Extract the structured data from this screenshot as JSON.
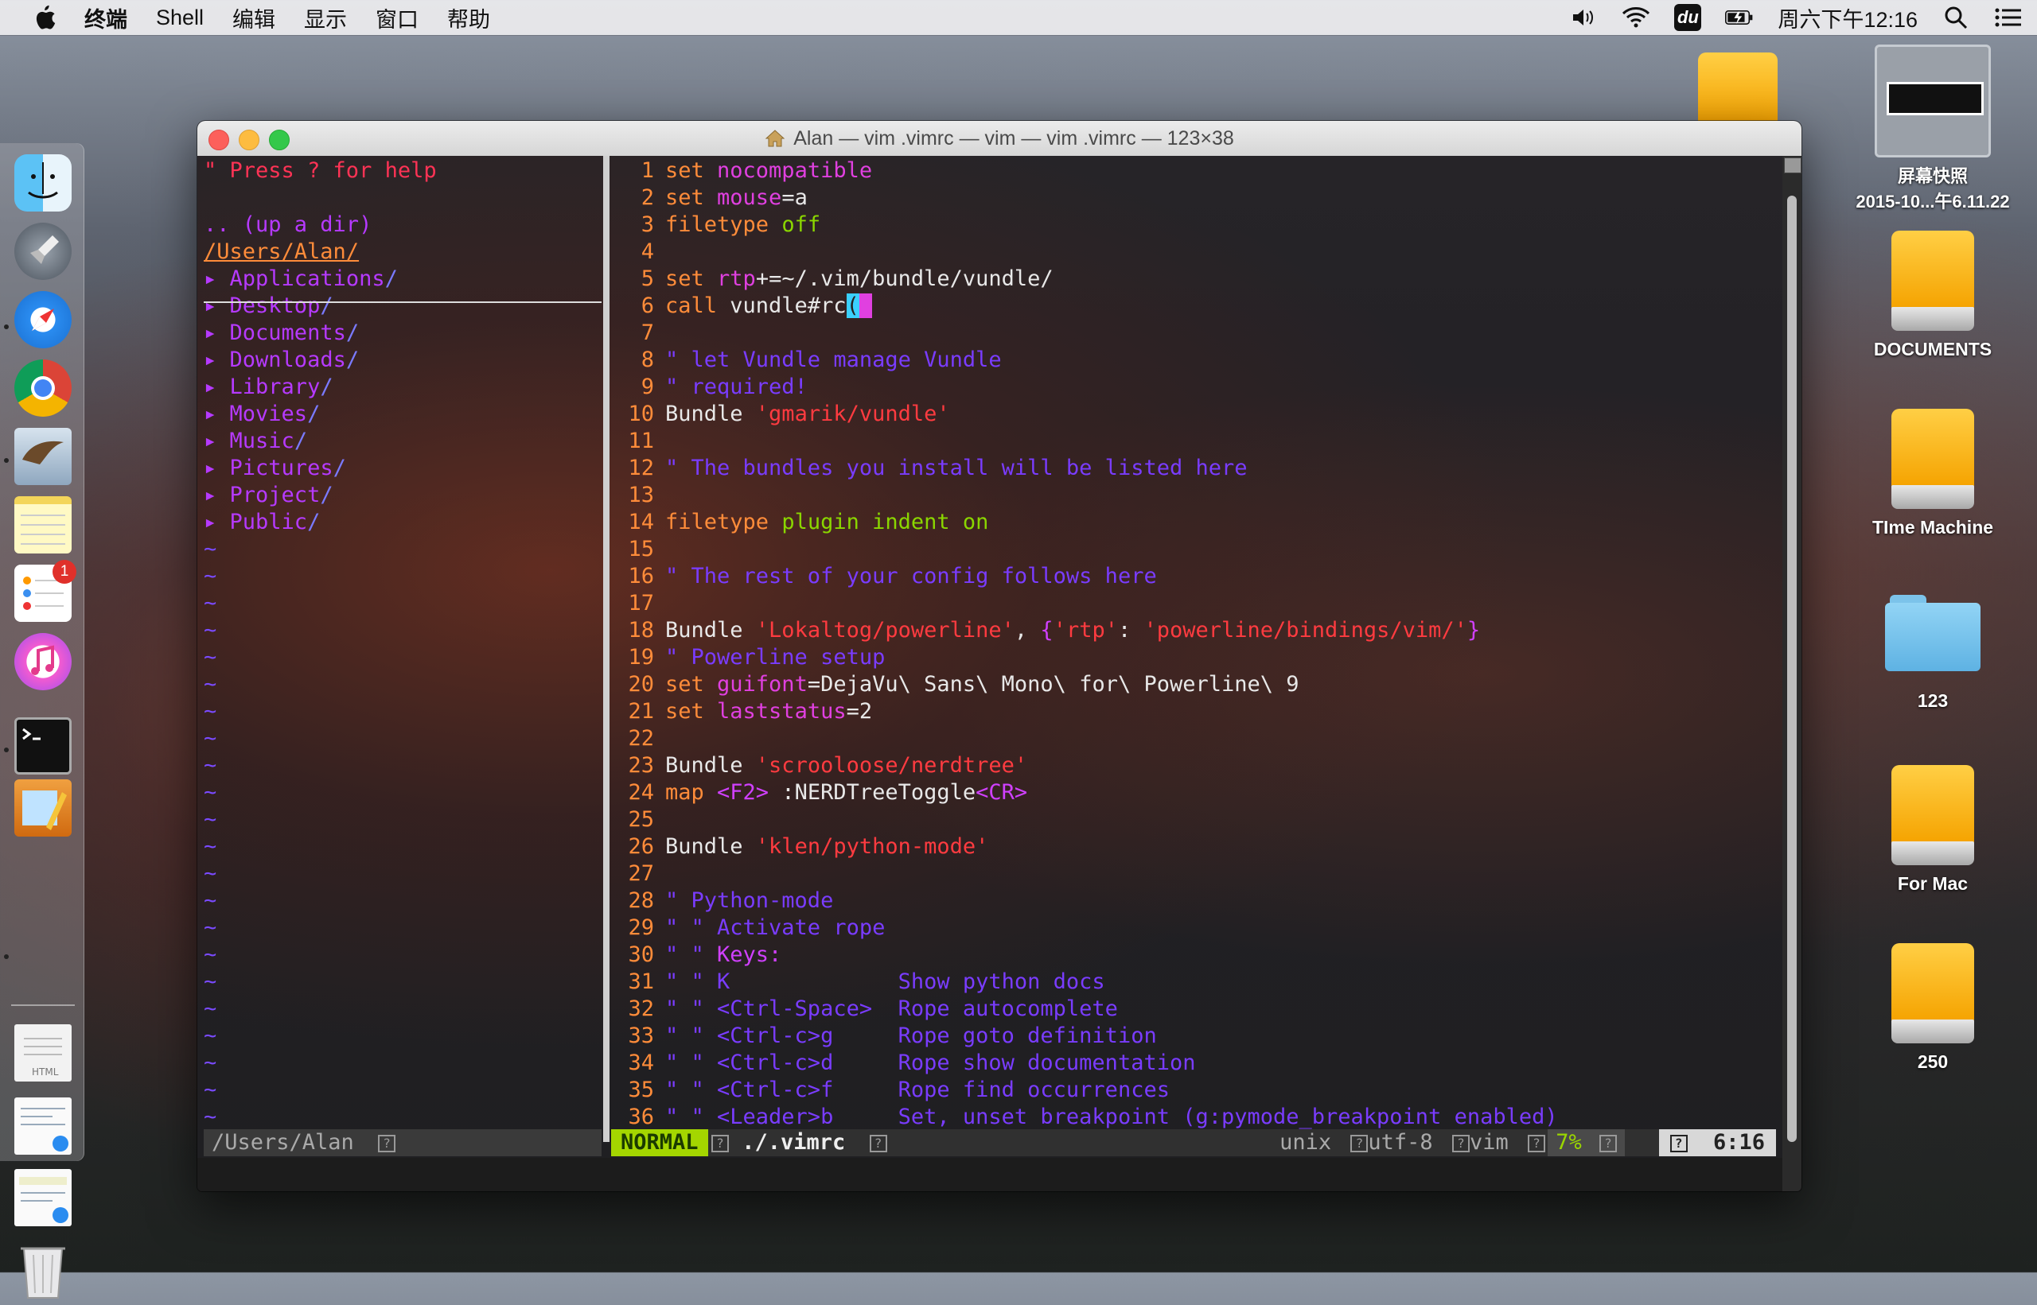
{
  "menubar": {
    "items": [
      "终端",
      "Shell",
      "编辑",
      "显示",
      "窗口",
      "帮助"
    ],
    "du_label": "du",
    "clock": "周六下午12:16"
  },
  "dock": {
    "reminders_badge": "1",
    "apps": [
      "finder-icon",
      "launchpad-icon",
      "safari-icon",
      "chrome-icon",
      "mail-icon",
      "notes-icon",
      "reminders-icon",
      "itunes-icon",
      "terminal-icon",
      "preview-icon",
      "html-file-icon",
      "doc-file-icon",
      "doc-file-icon",
      "trash-icon"
    ]
  },
  "desktop": {
    "icons": [
      {
        "label": "屏幕快照",
        "sub": "2015-10...午6.11.22"
      },
      {
        "label": "DOCUMENTS"
      },
      {
        "label": "TIme Machine"
      },
      {
        "label": "123"
      },
      {
        "label": "For Mac"
      },
      {
        "label": "250"
      }
    ]
  },
  "window": {
    "title": "Alan — vim .vimrc — vim — vim .vimrc — 123×38"
  },
  "tree": {
    "help": "\" Press ? for help",
    "updir": ".. (up a dir)",
    "cwd": "/Users/Alan/",
    "arrow": "▸",
    "dirs": [
      "Applications",
      "Desktop",
      "Documents",
      "Downloads",
      "Library",
      "Movies",
      "Music",
      "Pictures",
      "Project",
      "Public"
    ],
    "slash": "/",
    "tilde": "~",
    "status": "/Users/Alan"
  },
  "editor": {
    "lines": [
      {
        "n": "1",
        "segs": [
          {
            "t": "set ",
            "c": "k"
          },
          {
            "t": "nocompatible",
            "c": "o"
          }
        ]
      },
      {
        "n": "2",
        "segs": [
          {
            "t": "set ",
            "c": "k"
          },
          {
            "t": "mouse",
            "c": "o"
          },
          {
            "t": "=a",
            "c": "w"
          }
        ]
      },
      {
        "n": "3",
        "segs": [
          {
            "t": "filetype ",
            "c": "k"
          },
          {
            "t": "off",
            "c": "g"
          }
        ]
      },
      {
        "n": "4",
        "segs": []
      },
      {
        "n": "5",
        "segs": [
          {
            "t": "set ",
            "c": "k"
          },
          {
            "t": "rtp",
            "c": "o"
          },
          {
            "t": "+=~/.vim/bundle/vundle/",
            "c": "w"
          }
        ]
      },
      {
        "n": "6",
        "segs": [
          {
            "t": "call ",
            "c": "k"
          },
          {
            "t": "vundle#rc",
            "c": "w"
          },
          {
            "t": "(",
            "c": "cursor"
          },
          {
            "t": ")",
            "c": "cursor-end"
          }
        ]
      },
      {
        "n": "7",
        "segs": []
      },
      {
        "n": "8",
        "segs": [
          {
            "t": "\" let Vundle manage Vundle",
            "c": "c"
          }
        ]
      },
      {
        "n": "9",
        "segs": [
          {
            "t": "\" required!",
            "c": "c"
          }
        ]
      },
      {
        "n": "10",
        "segs": [
          {
            "t": "Bundle ",
            "c": "w"
          },
          {
            "t": "'gmarik/vundle'",
            "c": "s"
          }
        ]
      },
      {
        "n": "11",
        "segs": []
      },
      {
        "n": "12",
        "segs": [
          {
            "t": "\" The bundles you install will be listed here",
            "c": "c"
          }
        ]
      },
      {
        "n": "13",
        "segs": []
      },
      {
        "n": "14",
        "segs": [
          {
            "t": "filetype ",
            "c": "k"
          },
          {
            "t": "plugin indent on",
            "c": "g"
          }
        ]
      },
      {
        "n": "15",
        "segs": []
      },
      {
        "n": "16",
        "segs": [
          {
            "t": "\" The rest of your config follows here",
            "c": "c"
          }
        ]
      },
      {
        "n": "17",
        "segs": []
      },
      {
        "n": "18",
        "segs": [
          {
            "t": "Bundle ",
            "c": "w"
          },
          {
            "t": "'Lokaltog/powerline'",
            "c": "s"
          },
          {
            "t": ", ",
            "c": "w"
          },
          {
            "t": "{",
            "c": "p"
          },
          {
            "t": "'rtp'",
            "c": "s"
          },
          {
            "t": ": ",
            "c": "w"
          },
          {
            "t": "'powerline/bindings/vim/'",
            "c": "s"
          },
          {
            "t": "}",
            "c": "p"
          }
        ]
      },
      {
        "n": "19",
        "segs": [
          {
            "t": "\" Powerline setup",
            "c": "c"
          }
        ]
      },
      {
        "n": "20",
        "segs": [
          {
            "t": "set ",
            "c": "k"
          },
          {
            "t": "guifont",
            "c": "o"
          },
          {
            "t": "=DejaVu\\ Sans\\ Mono\\ for\\ Powerline\\ 9",
            "c": "w"
          }
        ]
      },
      {
        "n": "21",
        "segs": [
          {
            "t": "set ",
            "c": "k"
          },
          {
            "t": "laststatus",
            "c": "o"
          },
          {
            "t": "=2",
            "c": "w"
          }
        ]
      },
      {
        "n": "22",
        "segs": []
      },
      {
        "n": "23",
        "segs": [
          {
            "t": "Bundle ",
            "c": "w"
          },
          {
            "t": "'scrooloose/nerdtree'",
            "c": "s"
          }
        ]
      },
      {
        "n": "24",
        "segs": [
          {
            "t": "map ",
            "c": "k"
          },
          {
            "t": "<F2>",
            "c": "p"
          },
          {
            "t": " :NERDTreeToggle",
            "c": "w"
          },
          {
            "t": "<CR>",
            "c": "p"
          }
        ]
      },
      {
        "n": "25",
        "segs": []
      },
      {
        "n": "26",
        "segs": [
          {
            "t": "Bundle ",
            "c": "w"
          },
          {
            "t": "'klen/python-mode'",
            "c": "s"
          }
        ]
      },
      {
        "n": "27",
        "segs": []
      },
      {
        "n": "28",
        "segs": [
          {
            "t": "\" Python-mode",
            "c": "c"
          }
        ]
      },
      {
        "n": "29",
        "segs": [
          {
            "t": "\" \" Activate rope",
            "c": "c"
          }
        ]
      },
      {
        "n": "30",
        "segs": [
          {
            "t": "\" \" ",
            "c": "c"
          },
          {
            "t": "Keys:",
            "c": "p"
          }
        ]
      },
      {
        "n": "31",
        "segs": [
          {
            "t": "\" \" K             Show python docs",
            "c": "c"
          }
        ]
      },
      {
        "n": "32",
        "segs": [
          {
            "t": "\" \" <Ctrl-Space>  Rope autocomplete",
            "c": "c"
          }
        ]
      },
      {
        "n": "33",
        "segs": [
          {
            "t": "\" \" <Ctrl-c>g     Rope goto definition",
            "c": "c"
          }
        ]
      },
      {
        "n": "34",
        "segs": [
          {
            "t": "\" \" <Ctrl-c>d     Rope show documentation",
            "c": "c"
          }
        ]
      },
      {
        "n": "35",
        "segs": [
          {
            "t": "\" \" <Ctrl-c>f     Rope find occurrences",
            "c": "c"
          }
        ]
      },
      {
        "n": "36",
        "segs": [
          {
            "t": "\" \" <Leader>b     Set, unset breakpoint (g:pymode_breakpoint enabled)",
            "c": "c"
          }
        ]
      }
    ]
  },
  "status": {
    "mode": "NORMAL",
    "file": "./.vimrc",
    "fileformat": "unix",
    "encoding": "utf-8",
    "filetype": "vim",
    "percent": "7%",
    "position": "6:16",
    "box_glyph": "?"
  },
  "colors": {
    "keyword": "#ff8c3a",
    "option": "#e040e0",
    "comment": "#7a3cff",
    "string": "#ff3b40",
    "mode_bg": "#a4d600"
  }
}
